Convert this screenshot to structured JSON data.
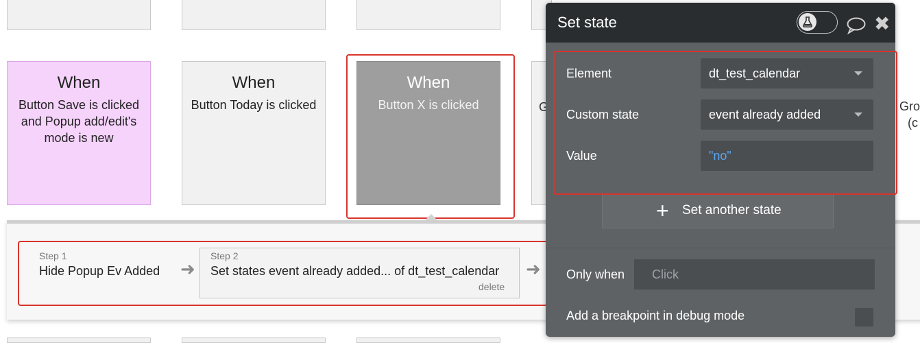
{
  "cards": [
    {
      "when": "When",
      "description": "Button Save is clicked and Popup add/edit's mode is new"
    },
    {
      "when": "When",
      "description": "Button Today is clicked"
    },
    {
      "when": "When",
      "description": "Button X is clicked"
    }
  ],
  "partial_texts": [
    "G",
    "Gro",
    "(c"
  ],
  "steps": [
    {
      "label": "Step 1",
      "title": "Hide Popup Ev Added"
    },
    {
      "label": "Step 2",
      "title": "Set states event already added... of dt_test_calendar",
      "delete": "delete"
    }
  ],
  "editor": {
    "title": "Set state",
    "fields": {
      "element": {
        "label": "Element",
        "value": "dt_test_calendar"
      },
      "custom_state": {
        "label": "Custom state",
        "value": "event already added"
      },
      "value": {
        "label": "Value",
        "value": "\"no\""
      }
    },
    "set_another_label": "Set another state",
    "only_when_label": "Only when",
    "only_when_placeholder": "Click",
    "breakpoint_label": "Add a breakpoint in debug mode"
  },
  "colors": {
    "highlight": "#d9342b",
    "selected_card": "#9e9e9e",
    "pink_card": "#f5d3fb",
    "editor_bg": "#5f6265",
    "editor_header": "#2a2d2f",
    "value_text": "#5aa6f0"
  },
  "icons": {
    "flask": "flask-icon",
    "comment": "comment-icon",
    "close": "close-icon",
    "plus": "plus-icon",
    "arrow": "arrow-right-icon",
    "dropdown": "chevron-down-icon"
  }
}
